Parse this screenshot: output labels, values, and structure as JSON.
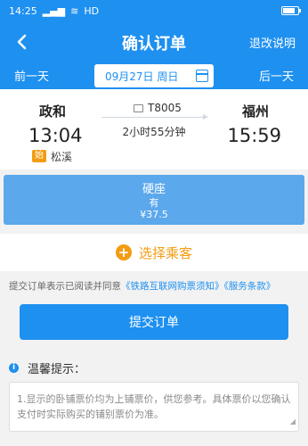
{
  "status": {
    "time": "14:25",
    "network": "HD",
    "battery_level": 0.8
  },
  "header": {
    "title": "确认订单",
    "back_icon": "chevron-left-icon",
    "refund_link": "退改说明"
  },
  "date_bar": {
    "prev_day": "前一天",
    "date": "09月27日 周日",
    "next_day": "后一天"
  },
  "train": {
    "from_station": "政和",
    "to_station": "福州",
    "depart_time": "13:04",
    "arrive_time": "15:59",
    "start_tag": "始",
    "via_station": "松溪",
    "train_no": "T8005",
    "duration": "2小时55分钟"
  },
  "seat": {
    "type": "硬座",
    "availability": "有",
    "price": "¥37.5"
  },
  "passenger": {
    "label": "选择乘客",
    "icon": "plus-icon"
  },
  "agreement": {
    "prefix": "提交订单表示已阅读并同意",
    "link1": "《铁路互联网购票须知》",
    "link2": "《服务条款》"
  },
  "submit_label": "提交订单",
  "tips": {
    "title": "温馨提示：",
    "text": "1.显示的卧铺票价均为上铺票价，供您参考。具体票价以您确认支付时实际购买的铺别票价为准。"
  },
  "colors": {
    "primary": "#1e90f0",
    "seat_selected": "#5ba8ec",
    "accent": "#f39c12"
  }
}
